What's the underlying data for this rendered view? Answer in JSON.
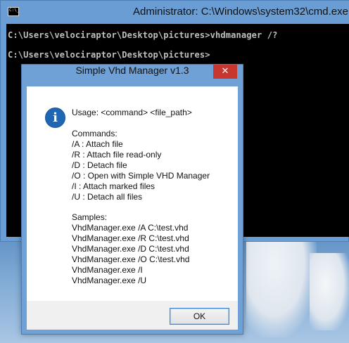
{
  "console": {
    "title": "Administrator: C:\\Windows\\system32\\cmd.exe",
    "icon_label": "C:\\_",
    "lines": [
      "C:\\Users\\velociraptor\\Desktop\\pictures>vhdmanager /?",
      "C:\\Users\\velociraptor\\Desktop\\pictures>"
    ]
  },
  "dialog": {
    "title": "Simple Vhd Manager v1.3",
    "close_label": "✕",
    "icon": "info-icon",
    "usage": "Usage: <command> <file_path>",
    "commands_header": "Commands:",
    "commands": [
      "/A : Attach file",
      "/R : Attach file read-only",
      "/D : Detach file",
      "/O : Open with Simple VHD Manager",
      "/I : Attach marked files",
      "/U : Detach all files"
    ],
    "samples_header": "Samples:",
    "samples": [
      "VhdManager.exe /A C:\\test.vhd",
      "VhdManager.exe /R C:\\test.vhd",
      "VhdManager.exe /D C:\\test.vhd",
      "VhdManager.exe /O C:\\test.vhd",
      "VhdManager.exe /I",
      "VhdManager.exe /U"
    ],
    "ok_label": "OK"
  },
  "colors": {
    "titlebar": "#6a9dd3",
    "close": "#c7372f",
    "info_icon": "#1f67b4",
    "console_bg": "#000000",
    "console_text": "#c0c0c0"
  }
}
